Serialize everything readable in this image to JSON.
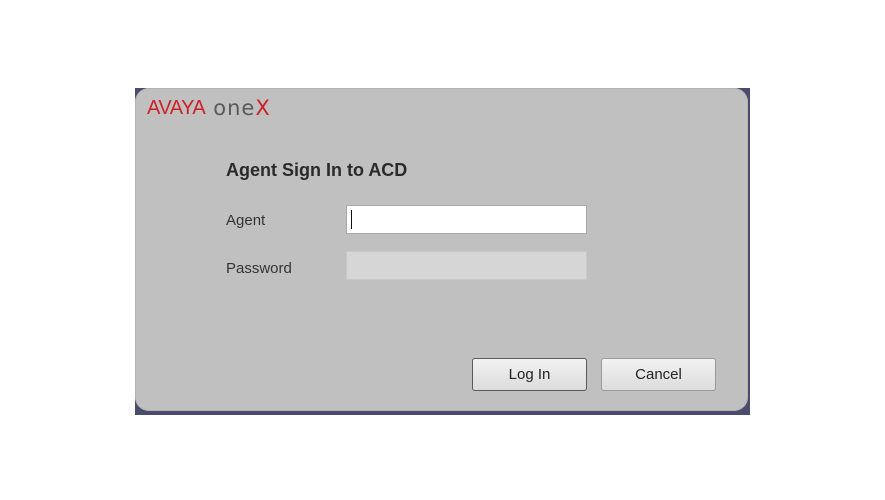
{
  "logo": {
    "brand": "AVAYA",
    "product": "one",
    "product_suffix": "X"
  },
  "dialog": {
    "title": "Agent Sign In to ACD"
  },
  "form": {
    "agent_label": "Agent",
    "agent_value": "",
    "password_label": "Password",
    "password_value": ""
  },
  "buttons": {
    "login_label": "Log In",
    "cancel_label": "Cancel"
  },
  "colors": {
    "brand_red": "#cc2127",
    "dialog_bg": "#c0c0c0",
    "frame": "#4a4c6e"
  }
}
